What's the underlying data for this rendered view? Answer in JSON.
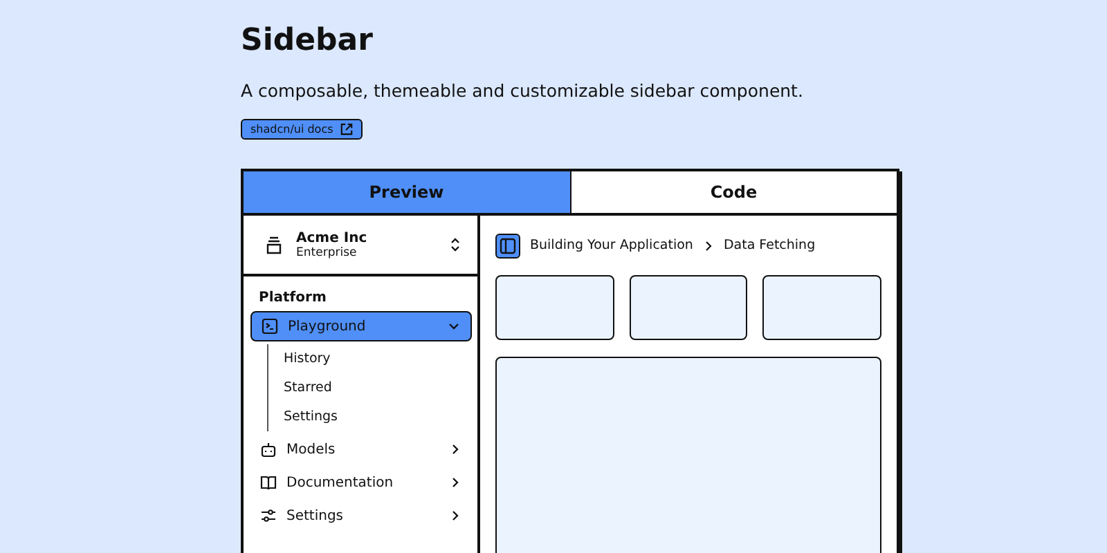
{
  "title": "Sidebar",
  "description": "A composable, themeable and customizable sidebar component.",
  "docs_link": "shadcn/ui docs",
  "tabs": [
    {
      "label": "Preview",
      "selected": true
    },
    {
      "label": "Code",
      "selected": false
    }
  ],
  "team": {
    "name": "Acme Inc",
    "plan": "Enterprise"
  },
  "sidebar": {
    "group_label": "Platform",
    "items": [
      {
        "label": "Playground",
        "selected": true,
        "expanded": true,
        "children": [
          {
            "label": "History"
          },
          {
            "label": "Starred"
          },
          {
            "label": "Settings"
          }
        ]
      },
      {
        "label": "Models",
        "selected": false,
        "expanded": false
      },
      {
        "label": "Documentation",
        "selected": false,
        "expanded": false
      },
      {
        "label": "Settings",
        "selected": false,
        "expanded": false
      }
    ]
  },
  "breadcrumb": [
    "Building Your Application",
    "Data Fetching"
  ]
}
